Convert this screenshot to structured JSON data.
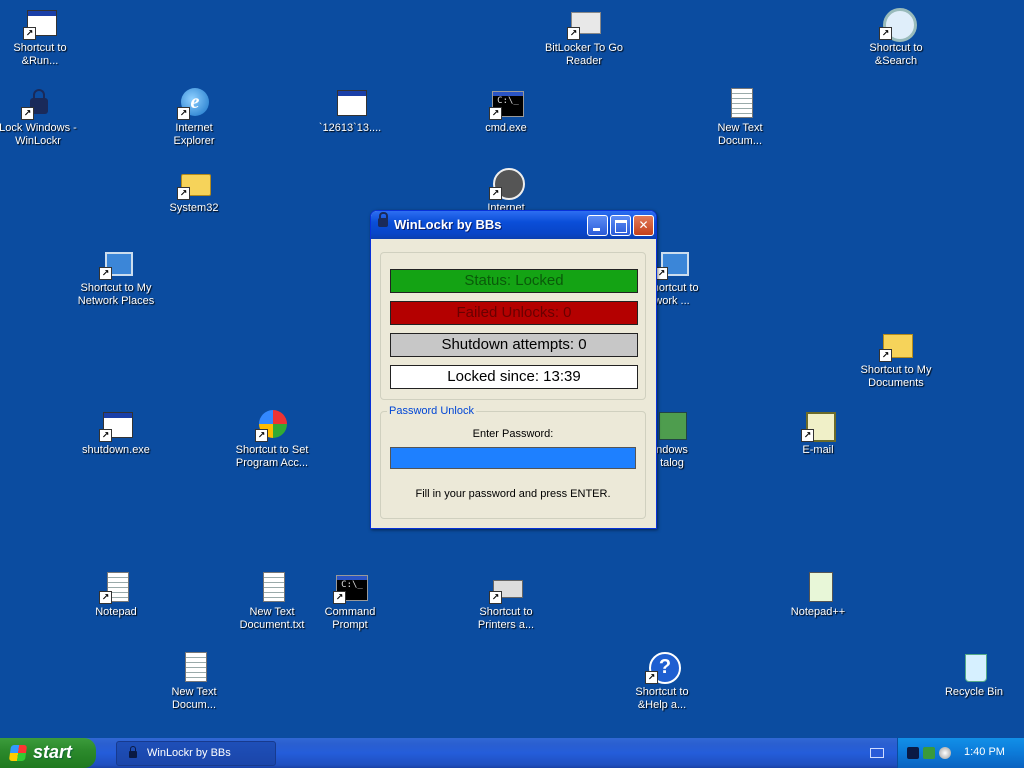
{
  "desktop": {
    "icons": [
      {
        "label": "Shortcut to\n&Run..."
      },
      {
        "label": "BitLocker To Go\nReader"
      },
      {
        "label": "Shortcut to\n&Search"
      },
      {
        "label": "Lock Windows -\nWinLockr"
      },
      {
        "label": "Internet\nExplorer"
      },
      {
        "label": "`12613`13...."
      },
      {
        "label": "cmd.exe"
      },
      {
        "label": "New Text\nDocum..."
      },
      {
        "label": "System32"
      },
      {
        "label": "Internet"
      },
      {
        "label": "Shortcut to My\nNetwork Places"
      },
      {
        "label": "Shortcut to\nwork ..."
      },
      {
        "label": "Shortcut to My\nDocuments"
      },
      {
        "label": "shutdown.exe"
      },
      {
        "label": "Shortcut to Set\nProgram Acc..."
      },
      {
        "label": "ndows\ntalog"
      },
      {
        "label": "E-mail"
      },
      {
        "label": "Notepad"
      },
      {
        "label": "New Text\nDocument.txt"
      },
      {
        "label": "Command\nPrompt"
      },
      {
        "label": "Shortcut to\nPrinters a..."
      },
      {
        "label": "Notepad++"
      },
      {
        "label": "New Text\nDocum..."
      },
      {
        "label": "Shortcut to\n&Help a..."
      },
      {
        "label": "Recycle Bin"
      }
    ]
  },
  "dialog": {
    "title": "WinLockr by BBs",
    "status": "Status: Locked",
    "failed_unlocks": "Failed Unlocks: 0",
    "shutdown_attempts": "Shutdown attempts: 0",
    "locked_since": "Locked since: 13:39",
    "password_group_label": "Password Unlock",
    "password_prompt": "Enter Password:",
    "password_value": "",
    "hint": "Fill in your password and press ENTER.",
    "minimize_glyph": "_",
    "maximize_glyph": "□",
    "close_glyph": "✕"
  },
  "taskbar": {
    "start_label": "start",
    "task_label": "WinLockr by BBs",
    "clock": "1:40 PM"
  },
  "colors": {
    "desktop": "#0b4ca0",
    "status_green": "#14a314",
    "failed_red": "#b40000",
    "password_blue": "#1e80ff"
  }
}
